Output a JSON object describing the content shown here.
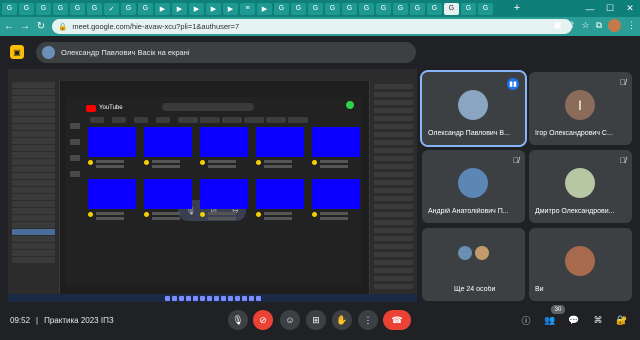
{
  "browser": {
    "tabs": [
      "G",
      "G",
      "G",
      "G",
      "G",
      "G",
      "✓",
      "G",
      "G",
      "▶",
      "▶",
      "▶",
      "▶",
      "▶",
      "≡",
      "▶",
      "G",
      "G",
      "G",
      "G",
      "G",
      "G",
      "G",
      "G",
      "G",
      "G",
      "G",
      "G",
      "G"
    ],
    "active_tab_index": 26,
    "url": "meet.google.com/hie-avaw-xcu?pli=1&authuser=7"
  },
  "presentation": {
    "banner_text": "Олександр Павлович Васік на екрані"
  },
  "shared_screen": {
    "app_name": "YouTube"
  },
  "participants": [
    {
      "name": "Олександр Павлович В...",
      "speaking": true,
      "avatar": "photo"
    },
    {
      "name": "Ігор Олександрович С...",
      "muted": true,
      "avatar_letter": "І"
    },
    {
      "name": "Андрій Анатолійович П...",
      "muted": true,
      "avatar": "photo"
    },
    {
      "name": "Дмитро Олександрови...",
      "muted": true,
      "avatar": "photo"
    },
    {
      "name": "Ще 24 особи",
      "avatar": "group"
    },
    {
      "name": "Ви",
      "avatar": "photo"
    }
  ],
  "footer": {
    "time": "09:52",
    "separator": "|",
    "meeting_title": "Практика 2023 ІПЗ",
    "participant_count": "30"
  },
  "colors": {
    "accent": "#1a73e8",
    "danger": "#ea4335",
    "tab_bar": "#0f7f7a",
    "thumbnail": "#0b00ff"
  }
}
